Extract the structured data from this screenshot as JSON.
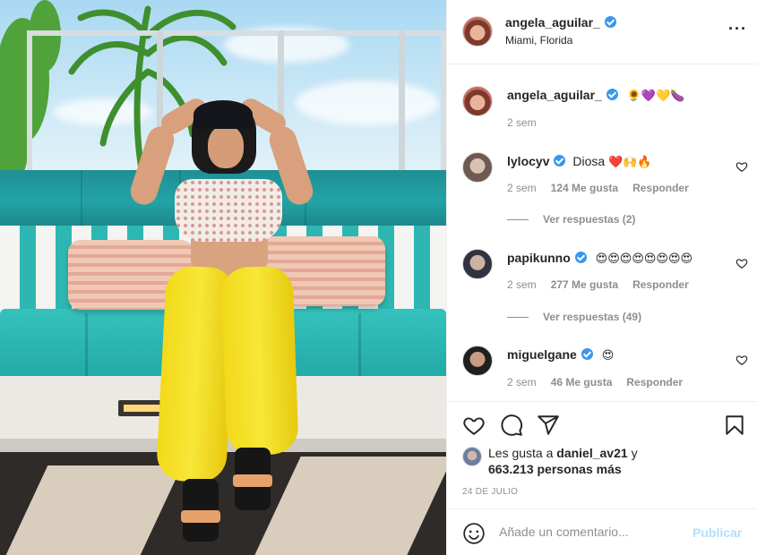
{
  "post": {
    "author": "angela_aguilar_",
    "location": "Miami, Florida",
    "more_icon": "more-horizontal-icon",
    "caption": {
      "username": "angela_aguilar_",
      "emojis": "🌻💜💛🍆",
      "time": "2 sem"
    },
    "comments": [
      {
        "username": "lylocyv",
        "text": "Diosa",
        "emojis": "❤️🙌🔥",
        "time": "2 sem",
        "likes": "124 Me gusta",
        "reply_label": "Responder",
        "view_replies": "Ver respuestas (2)"
      },
      {
        "username": "papikunno",
        "text": "",
        "emojis": "😍😍😍😍😍😍😍😍",
        "time": "2 sem",
        "likes": "277 Me gusta",
        "reply_label": "Responder",
        "view_replies": "Ver respuestas (49)"
      },
      {
        "username": "miguelgane",
        "text": "",
        "emojis": "😍",
        "time": "2 sem",
        "likes": "46 Me gusta",
        "reply_label": "Responder"
      }
    ],
    "likes": {
      "prefix": "Les gusta a",
      "user": "daniel_av21",
      "joiner": "y",
      "others": "663.213 personas más"
    },
    "date": "24 DE JULIO",
    "comment_box": {
      "placeholder": "Añade un comentario...",
      "submit_label": "Publicar"
    },
    "colors": {
      "verified": "#3897f0",
      "publish_disabled": "#b2dffc",
      "muted": "#8e8e8e"
    }
  }
}
